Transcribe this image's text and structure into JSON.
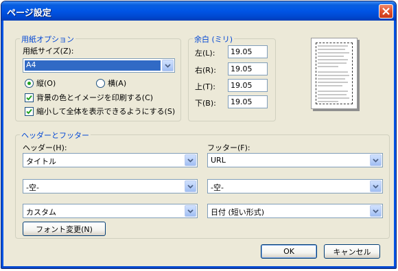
{
  "window": {
    "title": "ページ設定"
  },
  "paper": {
    "legend": "用紙オプション",
    "size_label": "用紙サイズ(Z):",
    "size_value": "A4",
    "orientation": {
      "portrait_label": "縦(O)",
      "landscape_label": "横(A)",
      "selected": "portrait"
    },
    "print_background_label": "背景の色とイメージを印刷する(C)",
    "print_background_checked": true,
    "shrink_to_fit_label": "縮小して全体を表示できるようにする(S)",
    "shrink_to_fit_checked": true
  },
  "margins": {
    "legend": "余白 (ミリ)",
    "left_label": "左(L):",
    "left_value": "19.05",
    "right_label": "右(R):",
    "right_value": "19.05",
    "top_label": "上(T):",
    "top_value": "19.05",
    "bottom_label": "下(B):",
    "bottom_value": "19.05"
  },
  "header_footer": {
    "legend": "ヘッダーとフッター",
    "header_label": "ヘッダー(H):",
    "footer_label": "フッター(F):",
    "header_1": "タイトル",
    "header_2": "-空-",
    "header_3": "カスタム",
    "footer_1": "URL",
    "footer_2": "-空-",
    "footer_3": "日付 (短い形式)",
    "font_button": "フォント変更(N)"
  },
  "buttons": {
    "ok": "OK",
    "cancel": "キャンセル"
  },
  "colors": {
    "titlebar": "#0055e5",
    "dialog_bg": "#ece9d8",
    "group_label": "#0046d5",
    "selection": "#316ac5"
  }
}
